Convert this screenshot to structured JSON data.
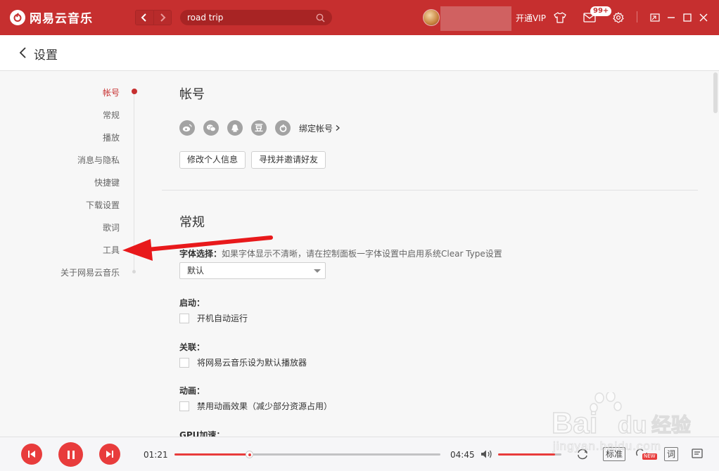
{
  "app": {
    "name": "网易云音乐"
  },
  "search": {
    "value": "road trip"
  },
  "header": {
    "vip_label": "开通VIP",
    "mail_badge": "99+"
  },
  "page": {
    "title": "设置"
  },
  "sidebar": {
    "items": [
      {
        "label": "帐号",
        "active": true
      },
      {
        "label": "常规"
      },
      {
        "label": "播放"
      },
      {
        "label": "消息与隐私"
      },
      {
        "label": "快捷键"
      },
      {
        "label": "下载设置"
      },
      {
        "label": "歌词"
      },
      {
        "label": "工具"
      },
      {
        "label": "关于网易云音乐"
      }
    ]
  },
  "account": {
    "title": "帐号",
    "social_icons": [
      "weibo-icon",
      "wechat-icon",
      "qq-icon",
      "douban-icon",
      "netease-icon"
    ],
    "douban_glyph": "豆",
    "bind_label": "绑定帐号",
    "edit_profile_label": "修改个人信息",
    "invite_label": "寻找并邀请好友"
  },
  "general": {
    "title": "常规",
    "font_label": "字体选择：",
    "font_desc": "如果字体显示不清晰，请在控制面板一字体设置中启用系统Clear Type设置",
    "font_value": "默认",
    "startup_label": "启动：",
    "startup_option": "开机自动运行",
    "assoc_label": "关联：",
    "assoc_option": "将网易云音乐设为默认播放器",
    "anim_label": "动画：",
    "anim_option": "禁用动画效果（减少部分资源占用）",
    "gpu_label": "GPU加速："
  },
  "player": {
    "elapsed": "01:21",
    "duration": "04:45",
    "progress_fraction": 0.284,
    "volume_fraction": 0.9,
    "quality_label": "标准",
    "lyrics_label": "词",
    "new_badge": "NEW"
  },
  "watermark": {
    "brand": "Bai",
    "brand_end": "du",
    "brand_cn": "经验",
    "url": "jingyan.baidu.com"
  },
  "colors": {
    "brand_red": "#c62f2f",
    "player_red": "#e83c3c",
    "annotation_red": "#e8191b"
  }
}
